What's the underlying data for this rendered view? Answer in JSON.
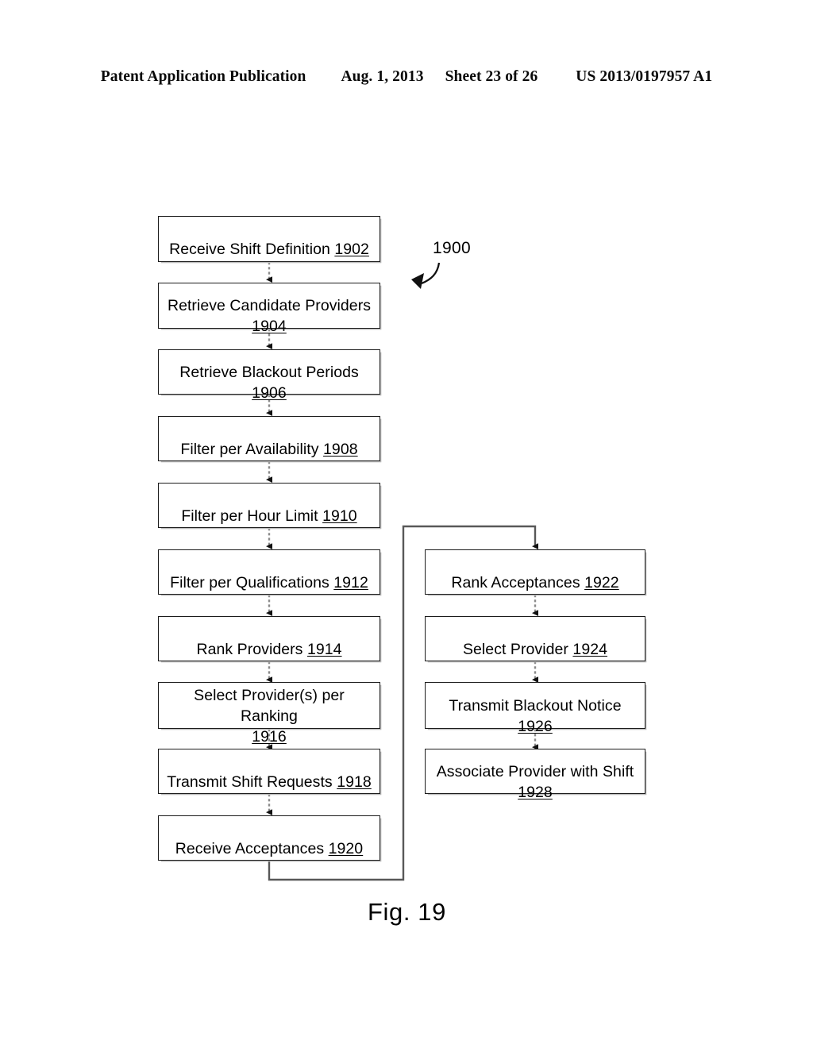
{
  "header": {
    "publication": "Patent Application Publication",
    "date": "Aug. 1, 2013",
    "sheet": "Sheet 23 of 26",
    "patent_number": "US 2013/0197957 A1"
  },
  "figure": {
    "caption": "Fig. 19",
    "diagram_reference": "1900"
  },
  "colors": {
    "ink": "#000000",
    "box_border": "#1b1b1b",
    "connector": "#4a4a4a",
    "shadow": "#b9b9b9",
    "page_background": "#ffffff"
  },
  "flowchart": {
    "left_column": [
      {
        "id": "1902",
        "text": "Receive Shift Definition ",
        "ref": "1902",
        "lines": 1
      },
      {
        "id": "1904",
        "text": "Retrieve Candidate Providers\n",
        "ref": "1904",
        "lines": 2
      },
      {
        "id": "1906",
        "text": "Retrieve Blackout Periods ",
        "ref": "1906",
        "lines": 1
      },
      {
        "id": "1908",
        "text": "Filter per Availability  ",
        "ref": "1908",
        "lines": 1
      },
      {
        "id": "1910",
        "text": "Filter per Hour Limit  ",
        "ref": "1910",
        "lines": 1
      },
      {
        "id": "1912",
        "text": "Filter per Qualifications  ",
        "ref": "1912",
        "lines": 1
      },
      {
        "id": "1914",
        "text": "Rank Providers ",
        "ref": "1914",
        "lines": 1
      },
      {
        "id": "1916",
        "text": "Select Provider(s) per Ranking\n",
        "ref": "1916",
        "lines": 2
      },
      {
        "id": "1918",
        "text": "Transmit Shift Requests ",
        "ref": "1918",
        "lines": 1
      },
      {
        "id": "1920",
        "text": "Receive Acceptances ",
        "ref": "1920",
        "lines": 1
      }
    ],
    "right_column": [
      {
        "id": "1922",
        "text": "Rank Acceptances ",
        "ref": "1922",
        "lines": 1
      },
      {
        "id": "1924",
        "text": "Select Provider ",
        "ref": "1924",
        "lines": 1
      },
      {
        "id": "1926",
        "text": "Transmit Blackout Notice ",
        "ref": "1926",
        "lines": 1
      },
      {
        "id": "1928",
        "text": "Associate Provider with Shift\n",
        "ref": "1928",
        "lines": 2
      }
    ],
    "edges": [
      {
        "from": "1902",
        "to": "1904",
        "style": "dashed-arrow"
      },
      {
        "from": "1904",
        "to": "1906",
        "style": "dashed-arrow"
      },
      {
        "from": "1906",
        "to": "1908",
        "style": "dashed-arrow"
      },
      {
        "from": "1908",
        "to": "1910",
        "style": "dashed-arrow"
      },
      {
        "from": "1910",
        "to": "1912",
        "style": "dashed-arrow"
      },
      {
        "from": "1912",
        "to": "1914",
        "style": "dashed-arrow"
      },
      {
        "from": "1914",
        "to": "1916",
        "style": "dashed-arrow"
      },
      {
        "from": "1916",
        "to": "1918",
        "style": "dashed-arrow"
      },
      {
        "from": "1918",
        "to": "1920",
        "style": "dashed-arrow"
      },
      {
        "from": "1920",
        "to": "1922",
        "style": "routed-arrow"
      },
      {
        "from": "1922",
        "to": "1924",
        "style": "dashed-arrow"
      },
      {
        "from": "1924",
        "to": "1926",
        "style": "dashed-arrow"
      },
      {
        "from": "1926",
        "to": "1928",
        "style": "dashed-arrow"
      }
    ]
  }
}
